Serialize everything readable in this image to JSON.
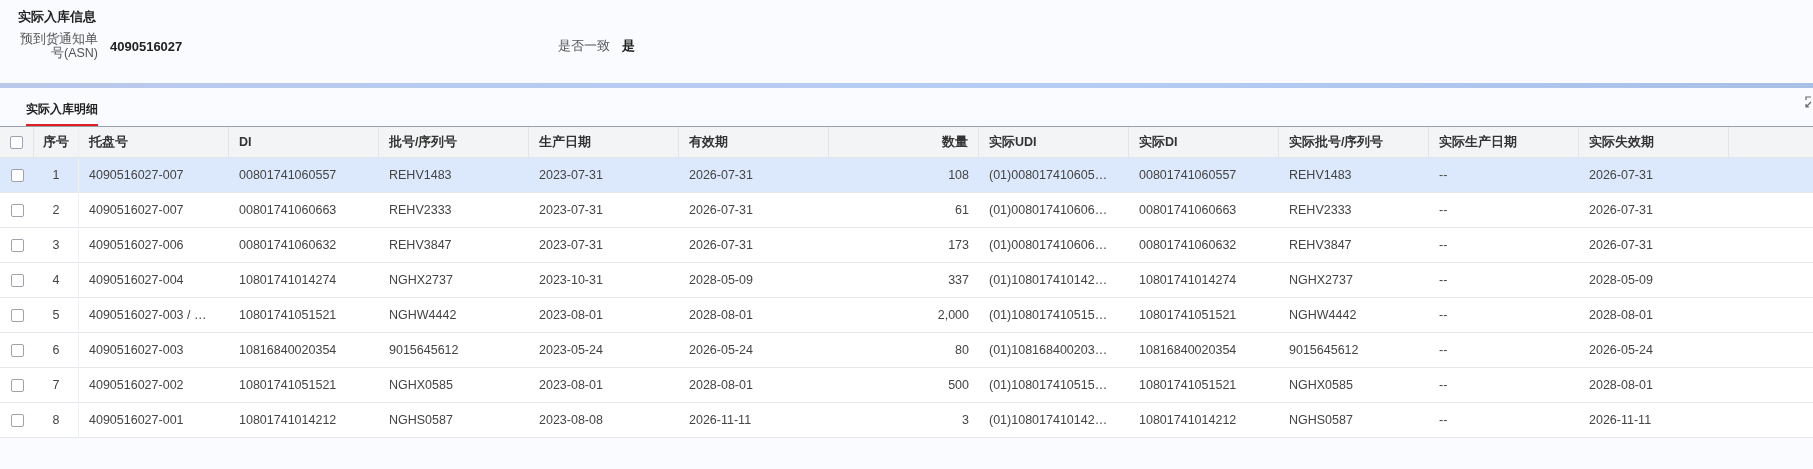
{
  "section": {
    "title": "实际入库信息",
    "fields": [
      {
        "label": "预到货通知单号(ASN)",
        "value": "4090516027"
      },
      {
        "label": "是否一致",
        "value": "是"
      }
    ]
  },
  "tabs": [
    {
      "label": "实际入库明细",
      "selected": true
    }
  ],
  "table": {
    "header_checkbox": {
      "checked": false
    },
    "columns": [
      "序号",
      "托盘号",
      "DI",
      "批号/序列号",
      "生产日期",
      "有效期",
      "数量",
      "实际UDI",
      "实际DI",
      "实际批号/序列号",
      "实际生产日期",
      "实际失效期"
    ],
    "rows": [
      {
        "selected": true,
        "checked": false,
        "cells": [
          "1",
          "4090516027-007",
          "00801741060557",
          "REHV1483",
          "2023-07-31",
          "2026-07-31",
          "108",
          "(01)008017410605…",
          "00801741060557",
          "REHV1483",
          "--",
          "2026-07-31"
        ]
      },
      {
        "selected": false,
        "checked": false,
        "cells": [
          "2",
          "4090516027-007",
          "00801741060663",
          "REHV2333",
          "2023-07-31",
          "2026-07-31",
          "61",
          "(01)008017410606…",
          "00801741060663",
          "REHV2333",
          "--",
          "2026-07-31"
        ]
      },
      {
        "selected": false,
        "checked": false,
        "cells": [
          "3",
          "4090516027-006",
          "00801741060632",
          "REHV3847",
          "2023-07-31",
          "2026-07-31",
          "173",
          "(01)008017410606…",
          "00801741060632",
          "REHV3847",
          "--",
          "2026-07-31"
        ]
      },
      {
        "selected": false,
        "checked": false,
        "cells": [
          "4",
          "4090516027-004",
          "10801741014274",
          "NGHX2737",
          "2023-10-31",
          "2028-05-09",
          "337",
          "(01)108017410142…",
          "10801741014274",
          "NGHX2737",
          "--",
          "2028-05-09"
        ]
      },
      {
        "selected": false,
        "checked": false,
        "cells": [
          "5",
          "4090516027-003 / …",
          "10801741051521",
          "NGHW4442",
          "2023-08-01",
          "2028-08-01",
          "2,000",
          "(01)108017410515…",
          "10801741051521",
          "NGHW4442",
          "--",
          "2028-08-01"
        ]
      },
      {
        "selected": false,
        "checked": false,
        "cells": [
          "6",
          "4090516027-003",
          "10816840020354",
          "9015645612",
          "2023-05-24",
          "2026-05-24",
          "80",
          "(01)108168400203…",
          "10816840020354",
          "9015645612",
          "--",
          "2026-05-24"
        ]
      },
      {
        "selected": false,
        "checked": false,
        "cells": [
          "7",
          "4090516027-002",
          "10801741051521",
          "NGHX0585",
          "2023-08-01",
          "2028-08-01",
          "500",
          "(01)108017410515…",
          "10801741051521",
          "NGHX0585",
          "--",
          "2028-08-01"
        ]
      },
      {
        "selected": false,
        "checked": false,
        "cells": [
          "8",
          "4090516027-001",
          "10801741014212",
          "NGHS0587",
          "2023-08-08",
          "2026-11-11",
          "3",
          "(01)108017410142…",
          "10801741014212",
          "NGHS0587",
          "--",
          "2026-11-11"
        ]
      }
    ]
  }
}
